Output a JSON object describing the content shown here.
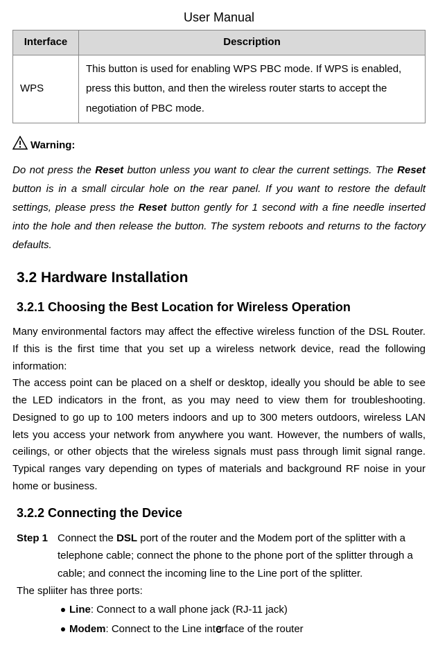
{
  "header": {
    "title": "User Manual"
  },
  "table": {
    "headers": {
      "col1": "Interface",
      "col2": "Description"
    },
    "row": {
      "interface": "WPS",
      "description": "This button is used for enabling WPS PBC mode. If WPS is enabled, press this button, and then the wireless router starts to accept the negotiation of PBC mode."
    }
  },
  "warning": {
    "label": "Warning:",
    "text_parts": {
      "p1": "Do not press the ",
      "b1": "Reset",
      "p2": " button unless you want to clear the current settings. The ",
      "b2": "Reset",
      "p3": " button is in a small circular hole on the rear panel. If you want to restore the default settings, please press the ",
      "b3": "Reset",
      "p4": " button gently for 1 second with a fine needle inserted into the hole and then release the button. The system reboots and returns to the factory defaults."
    }
  },
  "section32": {
    "title": "3.2   Hardware Installation"
  },
  "section321": {
    "title": "3.2.1   Choosing the Best Location for Wireless Operation",
    "body": "Many environmental factors may affect the effective wireless function of the DSL Router. If this is the first time that you set up a wireless network device, read the following information:\nThe access point can be placed on a shelf or desktop, ideally you should be able to see the LED indicators in the front, as you may need to view them for troubleshooting. Designed to go up to 100 meters indoors and up to 300 meters outdoors, wireless LAN lets you access your network from anywhere you want. However, the numbers of walls, ceilings, or other objects that the wireless signals must pass through limit signal range. Typical ranges vary depending on types of materials and background RF noise in your home or business."
  },
  "section322": {
    "title": "3.2.2   Connecting the Device",
    "step1": {
      "label": "Step 1",
      "t1": "Connect the ",
      "b1": "DSL",
      "t2": " port of the router and the Modem port of the splitter with a telephone cable; connect the phone to the phone port of the splitter through a cable; and connect the incoming line to the Line port of the splitter."
    },
    "splitter_intro": "The spliiter has three ports:",
    "bullets": {
      "line": {
        "b": "Line",
        "t": ": Connect to a wall phone jack (RJ-11 jack)"
      },
      "modem": {
        "b": "Modem",
        "t": ": Connect to the Line interface of the router"
      }
    }
  },
  "page_number": "8"
}
